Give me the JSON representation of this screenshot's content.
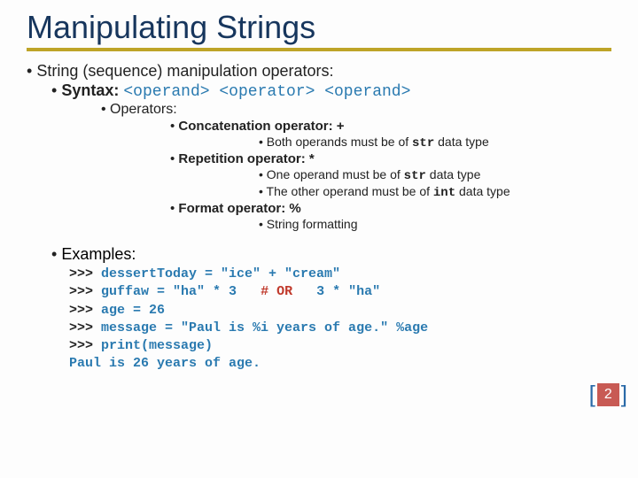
{
  "title": "Manipulating Strings",
  "l1": "String (sequence) manipulation operators:",
  "syntax_label": "Syntax:",
  "syntax_code": " <operand> <operator> <operand>",
  "operators_label": "Operators:",
  "concat": "Concatenation operator:  +",
  "concat_note": "Both operands must be of ",
  "concat_type": "str",
  "concat_note_tail": " data type",
  "rep": "Repetition operator:  *",
  "rep_note1_a": "One operand must be of ",
  "rep_note1_type": "str",
  "rep_note1_b": " data type",
  "rep_note2_a": "The other operand must be of ",
  "rep_note2_type": "int",
  "rep_note2_b": " data type",
  "fmt": "Format operator: %",
  "fmt_note": "String formatting",
  "examples_label": "Examples:",
  "ex1_prompt": ">>> ",
  "ex1_stmt": "dessertToday = \"ice\" + \"cream\"",
  "ex2_prompt": ">>> ",
  "ex2_stmt": "guffaw = \"ha\" * 3",
  "ex2_comment": "# OR",
  "ex2_tail": "3 * \"ha\"",
  "ex3_prompt": ">>> ",
  "ex3_stmt": "age = 26",
  "ex4_prompt": ">>> ",
  "ex4_stmt": "message = \"Paul is %i years of age.\" %age",
  "ex5_prompt": ">>> ",
  "ex5_stmt": "print(message)",
  "ex_output": "Paul is 26 years of age.",
  "page_number": "2"
}
